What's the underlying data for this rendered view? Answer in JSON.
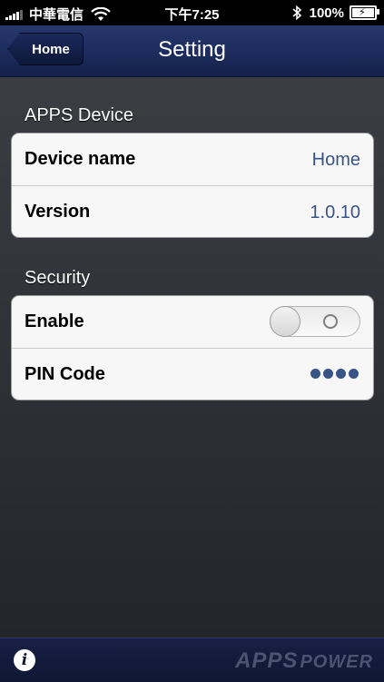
{
  "status_bar": {
    "carrier": "中華電信",
    "time": "下午7:25",
    "battery_percent": "100%"
  },
  "navbar": {
    "back_label": "Home",
    "title": "Setting"
  },
  "sections": [
    {
      "title": "APPS Device",
      "rows": [
        {
          "label": "Device name",
          "value": "Home"
        },
        {
          "label": "Version",
          "value": "1.0.10"
        }
      ]
    },
    {
      "title": "Security",
      "rows": [
        {
          "label": "Enable",
          "toggle_on": false
        },
        {
          "label": "PIN Code",
          "masked_value": "●●●●"
        }
      ]
    }
  ],
  "bottom_bar": {
    "brand_primary": "APPS",
    "brand_secondary": "POWER"
  },
  "icons": [
    "signal-icon",
    "wifi-icon",
    "bluetooth-icon",
    "battery-icon",
    "info-icon"
  ],
  "colors": {
    "nav_top": "#27386e",
    "nav_bottom": "#14214d",
    "value_text": "#385487",
    "bottom_bar": "#0f1634"
  }
}
